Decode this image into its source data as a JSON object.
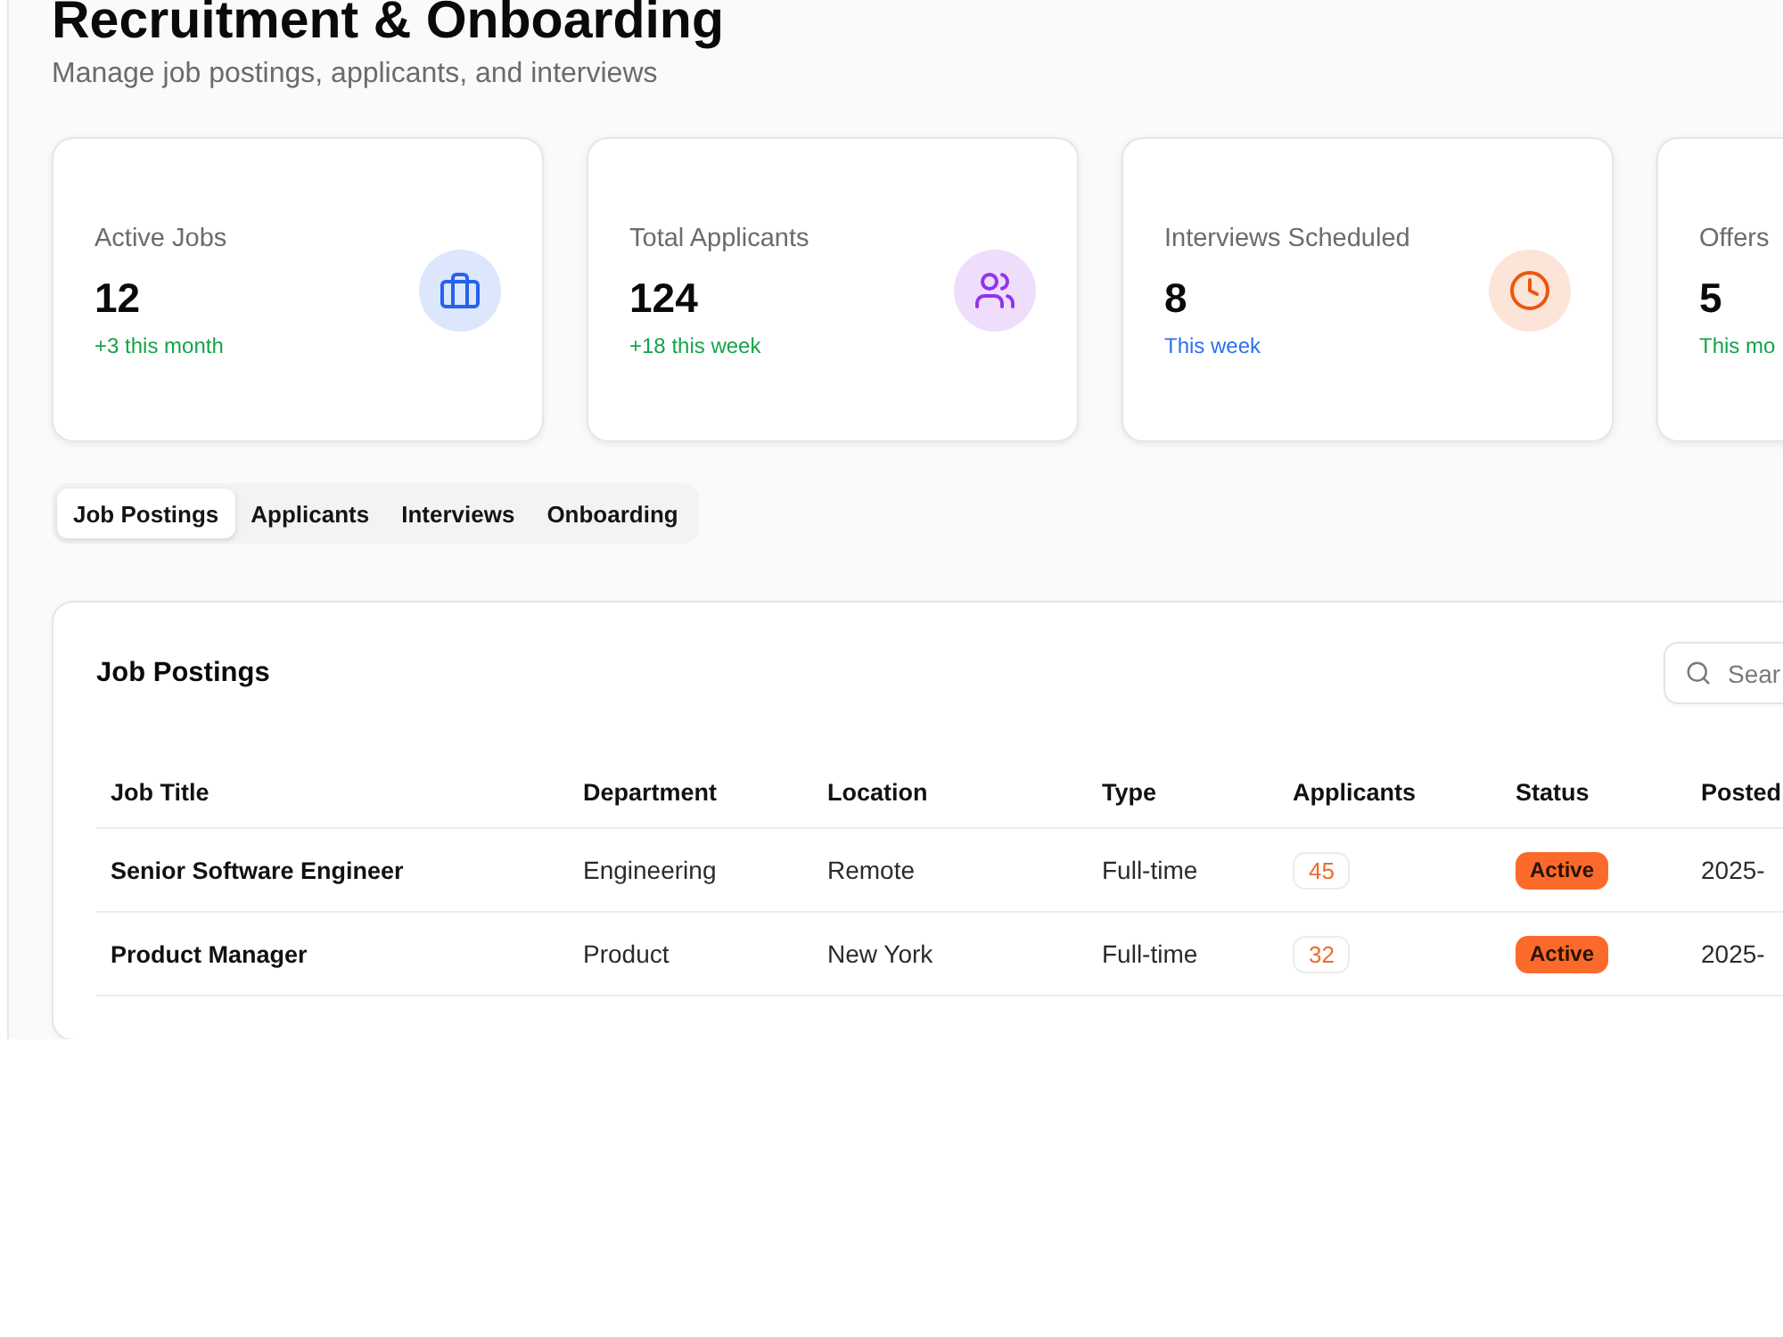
{
  "header": {
    "title": "Recruitment & Onboarding",
    "subtitle": "Manage job postings, applicants, and interviews"
  },
  "stats": [
    {
      "label": "Active Jobs",
      "value": "12",
      "note": {
        "text": "+3 this month",
        "color": "#16a34a"
      },
      "icon": {
        "kind": "briefcase",
        "color": "#2563eb"
      }
    },
    {
      "label": "Total Applicants",
      "value": "124",
      "note": {
        "text": "+18 this week",
        "color": "#16a34a"
      },
      "icon": {
        "kind": "users",
        "color": "#9333ea"
      }
    },
    {
      "label": "Interviews Scheduled",
      "value": "8",
      "note": {
        "text": "This week",
        "color": "#2f6fed"
      },
      "icon": {
        "kind": "clock",
        "color": "#ea580c"
      }
    },
    {
      "label": "Offers",
      "value": "5",
      "note": {
        "text": "This mo",
        "color": "#16a34a"
      }
    }
  ],
  "tabs": [
    {
      "label": "Job Postings",
      "selected": true
    },
    {
      "label": "Applicants",
      "selected": false
    },
    {
      "label": "Interviews",
      "selected": false
    },
    {
      "label": "Onboarding",
      "selected": false
    }
  ],
  "job_postings": {
    "title": "Job Postings",
    "search": {
      "placeholder": "Sear"
    },
    "columns": [
      "Job Title",
      "Department",
      "Location",
      "Type",
      "Applicants",
      "Status",
      "Posted"
    ],
    "rows": [
      {
        "title": "Senior Software Engineer",
        "department": "Engineering",
        "location": "Remote",
        "type": "Full-time",
        "applicants": "45",
        "status": "Active",
        "posted": "2025-"
      },
      {
        "title": "Product Manager",
        "department": "Product",
        "location": "New York",
        "type": "Full-time",
        "applicants": "32",
        "status": "Active",
        "posted": "2025-"
      }
    ]
  }
}
